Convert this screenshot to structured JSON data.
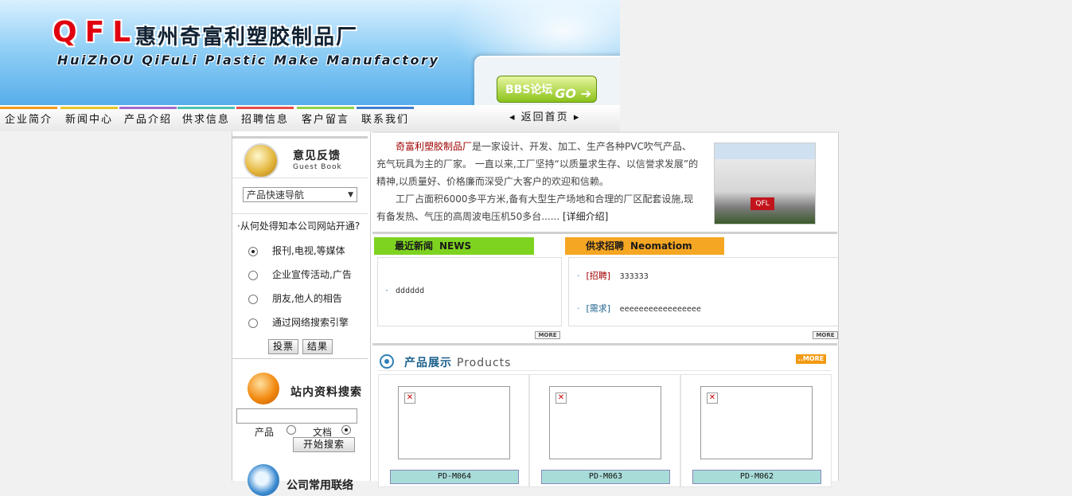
{
  "header": {
    "logo_mark": "QFL",
    "company_cn": "惠州奇富利塑胶制品厂",
    "company_en": "HuiZhOU QiFuLi Plastic Make Manufactory",
    "bbs_label": "BBS论坛",
    "bbs_go": "GO"
  },
  "nav": {
    "items": [
      "企业简介",
      "新闻中心",
      "产品介绍",
      "供求信息",
      "招聘信息",
      "客户留言",
      "联系我们"
    ],
    "item_colors": [
      "#f29a1e",
      "#e7c52a",
      "#9f6bd0",
      "#4cc1b6",
      "#e44b4b",
      "#8fd14a",
      "#3f7fd0"
    ],
    "home": "返回首页"
  },
  "guestbook": {
    "title": "意见反馈",
    "subtitle": "Guest Book"
  },
  "quick_nav": {
    "selected": "产品快速导航"
  },
  "poll": {
    "question": "·从何处得知本公司网站开通?",
    "options": [
      "报刊,电视,等媒体",
      "企业宣传活动,广告",
      "朋友,他人的相告",
      "通过网络搜索引擎"
    ],
    "selected_index": 0,
    "vote_label": "投票",
    "result_label": "结果"
  },
  "site_search": {
    "title": "站内资料搜索",
    "option_product": "产品",
    "option_document": "文档",
    "selected": "文档",
    "button": "开始搜索"
  },
  "contact": {
    "title": "公司常用联络"
  },
  "intro": {
    "brand": "奇富利塑胶制品厂",
    "text1": "是一家设计、开发、加工、生产各种PVC吹气产品、充气玩具为主的厂家。 一直以来,工厂坚持“以质量求生存、以信誉求发展”的精神,以质量好、价格廉而深受广大客户的欢迎和信赖。",
    "text2": "工厂占面积6000多平方米,备有大型生产场地和合理的厂区配套设施,现有备发热、气压的高周波电压机50多台......",
    "detail_link": "[详细介绍]",
    "photo_sign": "QFL"
  },
  "news": {
    "title": "最近新闻",
    "title_en": "NEWS",
    "color": "#7ed321",
    "items": [
      "dddddd"
    ],
    "more": "MORE"
  },
  "supply": {
    "title": "供求招聘",
    "title_en": "Neomatiom",
    "color": "#f5a623",
    "items": [
      {
        "tag": "[招聘]",
        "text": "333333"
      },
      {
        "tag": "[需求]",
        "text": "eeeeeeeeeeeeeeeee"
      }
    ],
    "more": "MORE"
  },
  "products": {
    "title": "产品展示",
    "title_en": "Products",
    "more": "MORE",
    "items": [
      {
        "name": "PD-M064"
      },
      {
        "name": "PD-M063"
      },
      {
        "name": "PD-M062"
      }
    ]
  }
}
